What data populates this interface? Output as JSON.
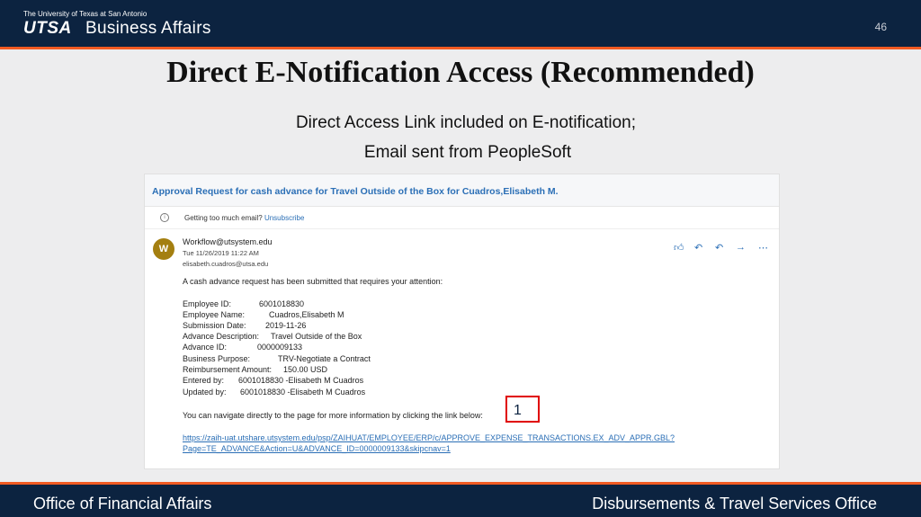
{
  "header": {
    "logo_sub": "The University of Texas at San Antonio",
    "logo_main": "UTSA",
    "logo_dept": "Business Affairs",
    "page_number": "46"
  },
  "slide": {
    "title": "Direct E-Notification Access (Recommended)",
    "subtitle_line1": "Direct Access Link included on E-notification;",
    "subtitle_line2": "Email sent from PeopleSoft"
  },
  "email": {
    "subject": "Approval Request for cash advance for Travel Outside of the Box for Cuadros,Elisabeth M.",
    "info_text": "Getting too much email?",
    "unsubscribe": "Unsubscribe",
    "avatar_letter": "W",
    "from": "Workflow@utsystem.edu",
    "date": "Tue 11/26/2019 11:22 AM",
    "to": "elisabeth.cuadros@utsa.edu",
    "actions": [
      "like-icon",
      "reply-icon",
      "reply-all-icon",
      "forward-icon",
      "more-icon"
    ],
    "intro": "A cash advance request has been submitted that requires your attention:",
    "fields": [
      {
        "label": "Employee ID:",
        "value": "6001018830"
      },
      {
        "label": "Employee Name:",
        "value": "Cuadros,Elisabeth M"
      },
      {
        "label": "Submission Date:",
        "value": "2019-11-26"
      },
      {
        "label": "Advance Description:",
        "value": "Travel Outside of the Box"
      },
      {
        "label": "Advance ID:",
        "value": "0000009133"
      },
      {
        "label": "Business Purpose:",
        "value": "TRV-Negotiate a Contract"
      },
      {
        "label": "Reimbursement Amount:",
        "value": "150.00 USD"
      },
      {
        "label": "Entered by:",
        "value": "6001018830 -Elisabeth M Cuadros"
      },
      {
        "label": "Updated by:",
        "value": "6001018830 -Elisabeth M Cuadros"
      }
    ],
    "nav_text": "You can navigate directly to the page for more information by clicking the link below:",
    "link_line1": "https://zaih-uat.utshare.utsystem.edu/psp/ZAIHUAT/EMPLOYEE/ERP/c/APPROVE_EXPENSE_TRANSACTIONS.EX_ADV_APPR.GBL?",
    "link_line2": "Page=TE_ADVANCE&Action=U&ADVANCE_ID=0000009133&skipcnav=1"
  },
  "callout": {
    "label": "1"
  },
  "footer": {
    "left": "Office of Financial Affairs",
    "right": "Disbursements & Travel Services Office"
  },
  "colors": {
    "navy": "#0c2340",
    "orange": "#f15a22",
    "link": "#2b6fb6",
    "callout": "#e00000"
  }
}
